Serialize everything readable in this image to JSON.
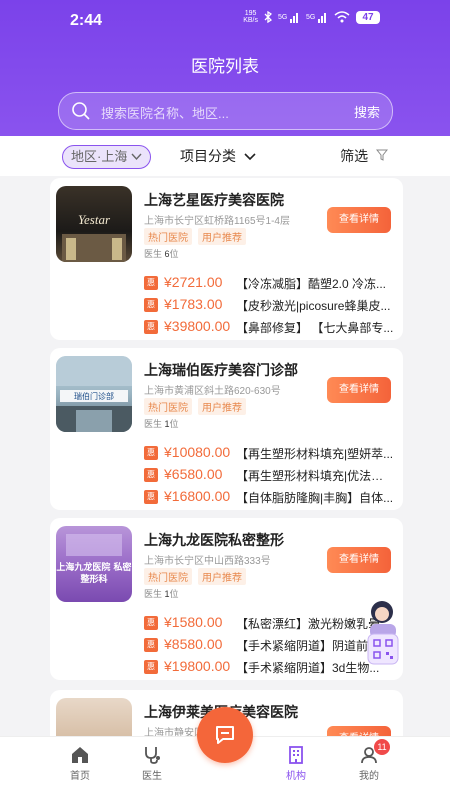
{
  "status": {
    "time": "2:44",
    "net_speed": "195",
    "net_unit": "KB/s",
    "battery": "47"
  },
  "title": "医院列表",
  "search": {
    "placeholder": "搜索医院名称、地区...",
    "button": "搜索"
  },
  "filters": {
    "region": "地区·上海",
    "category": "项目分类",
    "screen": "筛选"
  },
  "hospitals": [
    {
      "name": "上海艺星医疗美容医院",
      "address": "上海市长宁区虹桥路1165号1-4层",
      "tags": [
        "热门医院",
        "用户推荐"
      ],
      "doctor_label": "医生",
      "doctor_count": "6",
      "doctor_unit": "位",
      "detail_button": "查看详情",
      "thumb_text": "Yestar",
      "deals": [
        {
          "badge": "惠",
          "price": "¥2721.00",
          "text": "【冷冻减脂】酷塑2.0 冷冻..."
        },
        {
          "badge": "惠",
          "price": "¥1783.00",
          "text": "【皮秒激光|picosure蜂巢皮..."
        },
        {
          "badge": "惠",
          "price": "¥39800.00",
          "text": "【鼻部修复】 【七大鼻部专..."
        }
      ]
    },
    {
      "name": "上海瑞伯医疗美容门诊部",
      "address": "上海市黄浦区斜土路620-630号",
      "tags": [
        "热门医院",
        "用户推荐"
      ],
      "doctor_label": "医生",
      "doctor_count": "1",
      "doctor_unit": "位",
      "detail_button": "查看详情",
      "thumb_text": "瑞伯门诊部",
      "deals": [
        {
          "badge": "惠",
          "price": "¥10080.00",
          "text": "【再生塑形材料填充|塑妍萃..."
        },
        {
          "badge": "惠",
          "price": "¥6580.00",
          "text": "【再生塑形材料填充|优法兰|..."
        },
        {
          "badge": "惠",
          "price": "¥16800.00",
          "text": "【自体脂肪隆胸|丰胸】自体..."
        }
      ]
    },
    {
      "name": "上海九龙医院私密整形",
      "address": "上海市长宁区中山西路333号",
      "tags": [
        "热门医院",
        "用户推荐"
      ],
      "doctor_label": "医生",
      "doctor_count": "1",
      "doctor_unit": "位",
      "detail_button": "查看详情",
      "thumb_text": "上海九龙医院 私密整形科",
      "deals": [
        {
          "badge": "惠",
          "price": "¥1580.00",
          "text": "【私密漂红】激光粉嫩乳晕..."
        },
        {
          "badge": "惠",
          "price": "¥8580.00",
          "text": "【手术紧缩阴道】阴道前..."
        },
        {
          "badge": "惠",
          "price": "¥19800.00",
          "text": "【手术紧缩阴道】3d生物..."
        }
      ]
    },
    {
      "name": "上海伊莱美医疗美容医院",
      "address": "上海市静安区",
      "detail_button": "查看详情"
    }
  ],
  "tabs": [
    {
      "label": "首页",
      "icon": "home-icon"
    },
    {
      "label": "医生",
      "icon": "stethoscope-icon"
    },
    {
      "label": "机构",
      "icon": "building-icon"
    },
    {
      "label": "我的",
      "icon": "user-icon"
    }
  ],
  "profile_badge": "11",
  "colors": {
    "primary": "#7b42ea",
    "accent": "#f4663a"
  }
}
